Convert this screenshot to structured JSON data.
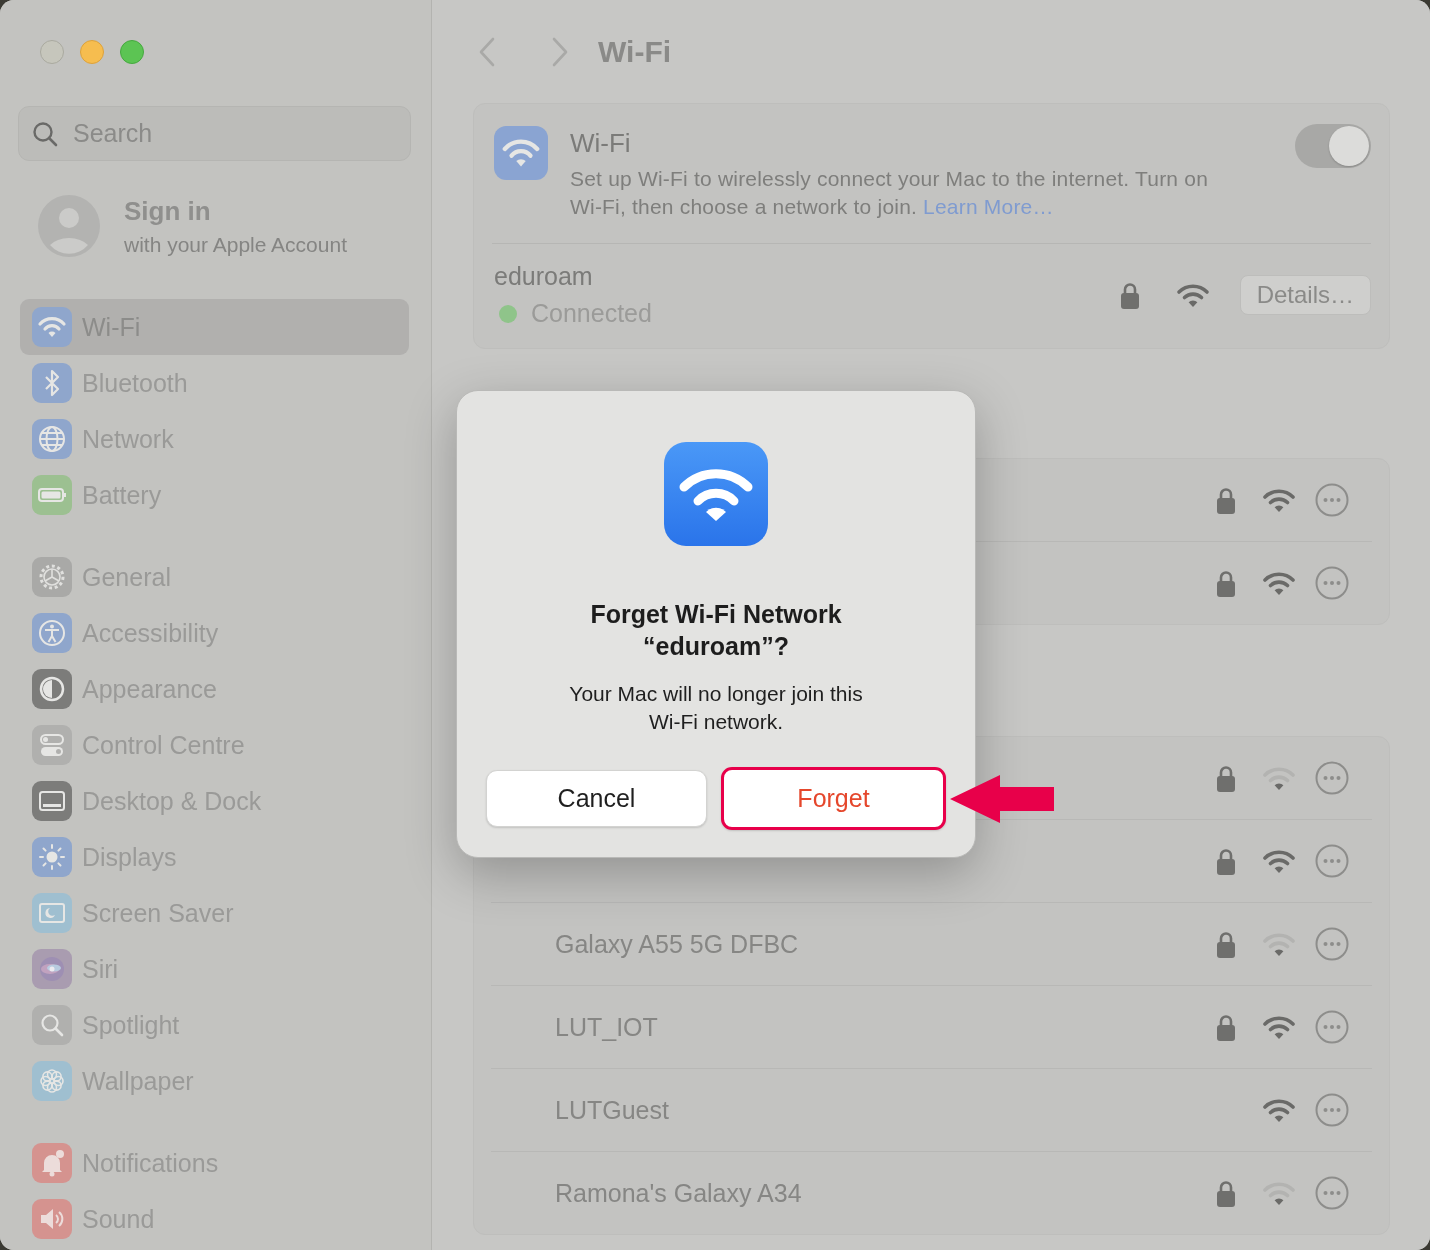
{
  "sidebar": {
    "search": {
      "placeholder": "Search"
    },
    "account": {
      "title": "Sign in",
      "subtitle": "with your Apple Account"
    },
    "groups": [
      [
        {
          "label": "Wi-Fi",
          "kind": "wifi",
          "color": "#8fa6cc",
          "selected": true
        },
        {
          "label": "Bluetooth",
          "kind": "bluetooth",
          "color": "#8fa6cc",
          "selected": false
        },
        {
          "label": "Network",
          "kind": "globe",
          "color": "#8fa6cc",
          "selected": false
        },
        {
          "label": "Battery",
          "kind": "battery",
          "color": "#9cc091",
          "selected": false
        }
      ],
      [
        {
          "label": "General",
          "kind": "gear",
          "color": "#a9a9a7",
          "selected": false
        },
        {
          "label": "Accessibility",
          "kind": "accessibility",
          "color": "#8fa6cc",
          "selected": false
        },
        {
          "label": "Appearance",
          "kind": "appearance",
          "color": "#7c7c7a",
          "selected": false
        },
        {
          "label": "Control Centre",
          "kind": "toggles",
          "color": "#b0b0ae",
          "selected": false
        },
        {
          "label": "Desktop & Dock",
          "kind": "dock",
          "color": "#7c7c7a",
          "selected": false
        },
        {
          "label": "Displays",
          "kind": "sun",
          "color": "#8fa6cc",
          "selected": false
        },
        {
          "label": "Screen Saver",
          "kind": "screensaver",
          "color": "#9fbfd0",
          "selected": false
        },
        {
          "label": "Siri",
          "kind": "siri",
          "color": "#a99cb0",
          "selected": false
        },
        {
          "label": "Spotlight",
          "kind": "search",
          "color": "#b0b0ae",
          "selected": false
        },
        {
          "label": "Wallpaper",
          "kind": "flower",
          "color": "#9fbfd0",
          "selected": false
        }
      ],
      [
        {
          "label": "Notifications",
          "kind": "bell",
          "color": "#d5938f",
          "selected": false
        },
        {
          "label": "Sound",
          "kind": "speaker",
          "color": "#d5938f",
          "selected": false
        }
      ]
    ]
  },
  "pane": {
    "title": "Wi-Fi",
    "wifi_card": {
      "title": "Wi-Fi",
      "description": "Set up Wi-Fi to wirelessly connect your Mac to the internet. Turn on Wi-Fi, then choose a network to join.",
      "link": "Learn More…",
      "on": true,
      "current": {
        "name": "eduroam",
        "status": "Connected",
        "locked": true,
        "weak": false,
        "button": "Details…"
      }
    },
    "lists": [
      {
        "rows": [
          {
            "locked": true,
            "weak": false
          },
          {
            "locked": true,
            "weak": false
          }
        ]
      },
      {
        "rows": [
          {
            "locked": true,
            "weak": true
          },
          {
            "locked": true,
            "weak": false
          },
          {
            "name": "Galaxy A55 5G DFBC",
            "locked": true,
            "weak": true
          },
          {
            "name": "LUT_IOT",
            "locked": true,
            "weak": false
          },
          {
            "name": "LUTGuest",
            "locked": false,
            "weak": false
          },
          {
            "name": "Ramona's Galaxy A34",
            "locked": true,
            "weak": true
          }
        ]
      }
    ]
  },
  "dialog": {
    "title": "Forget Wi-Fi Network “eduroam”?",
    "message": "Your Mac will no longer join this Wi-Fi network.",
    "buttons": [
      {
        "label": "Cancel",
        "kind": "cancel",
        "highlighted": false
      },
      {
        "label": "Forget",
        "kind": "destructive",
        "highlighted": true
      }
    ]
  },
  "callout": {
    "kind": "arrow"
  }
}
